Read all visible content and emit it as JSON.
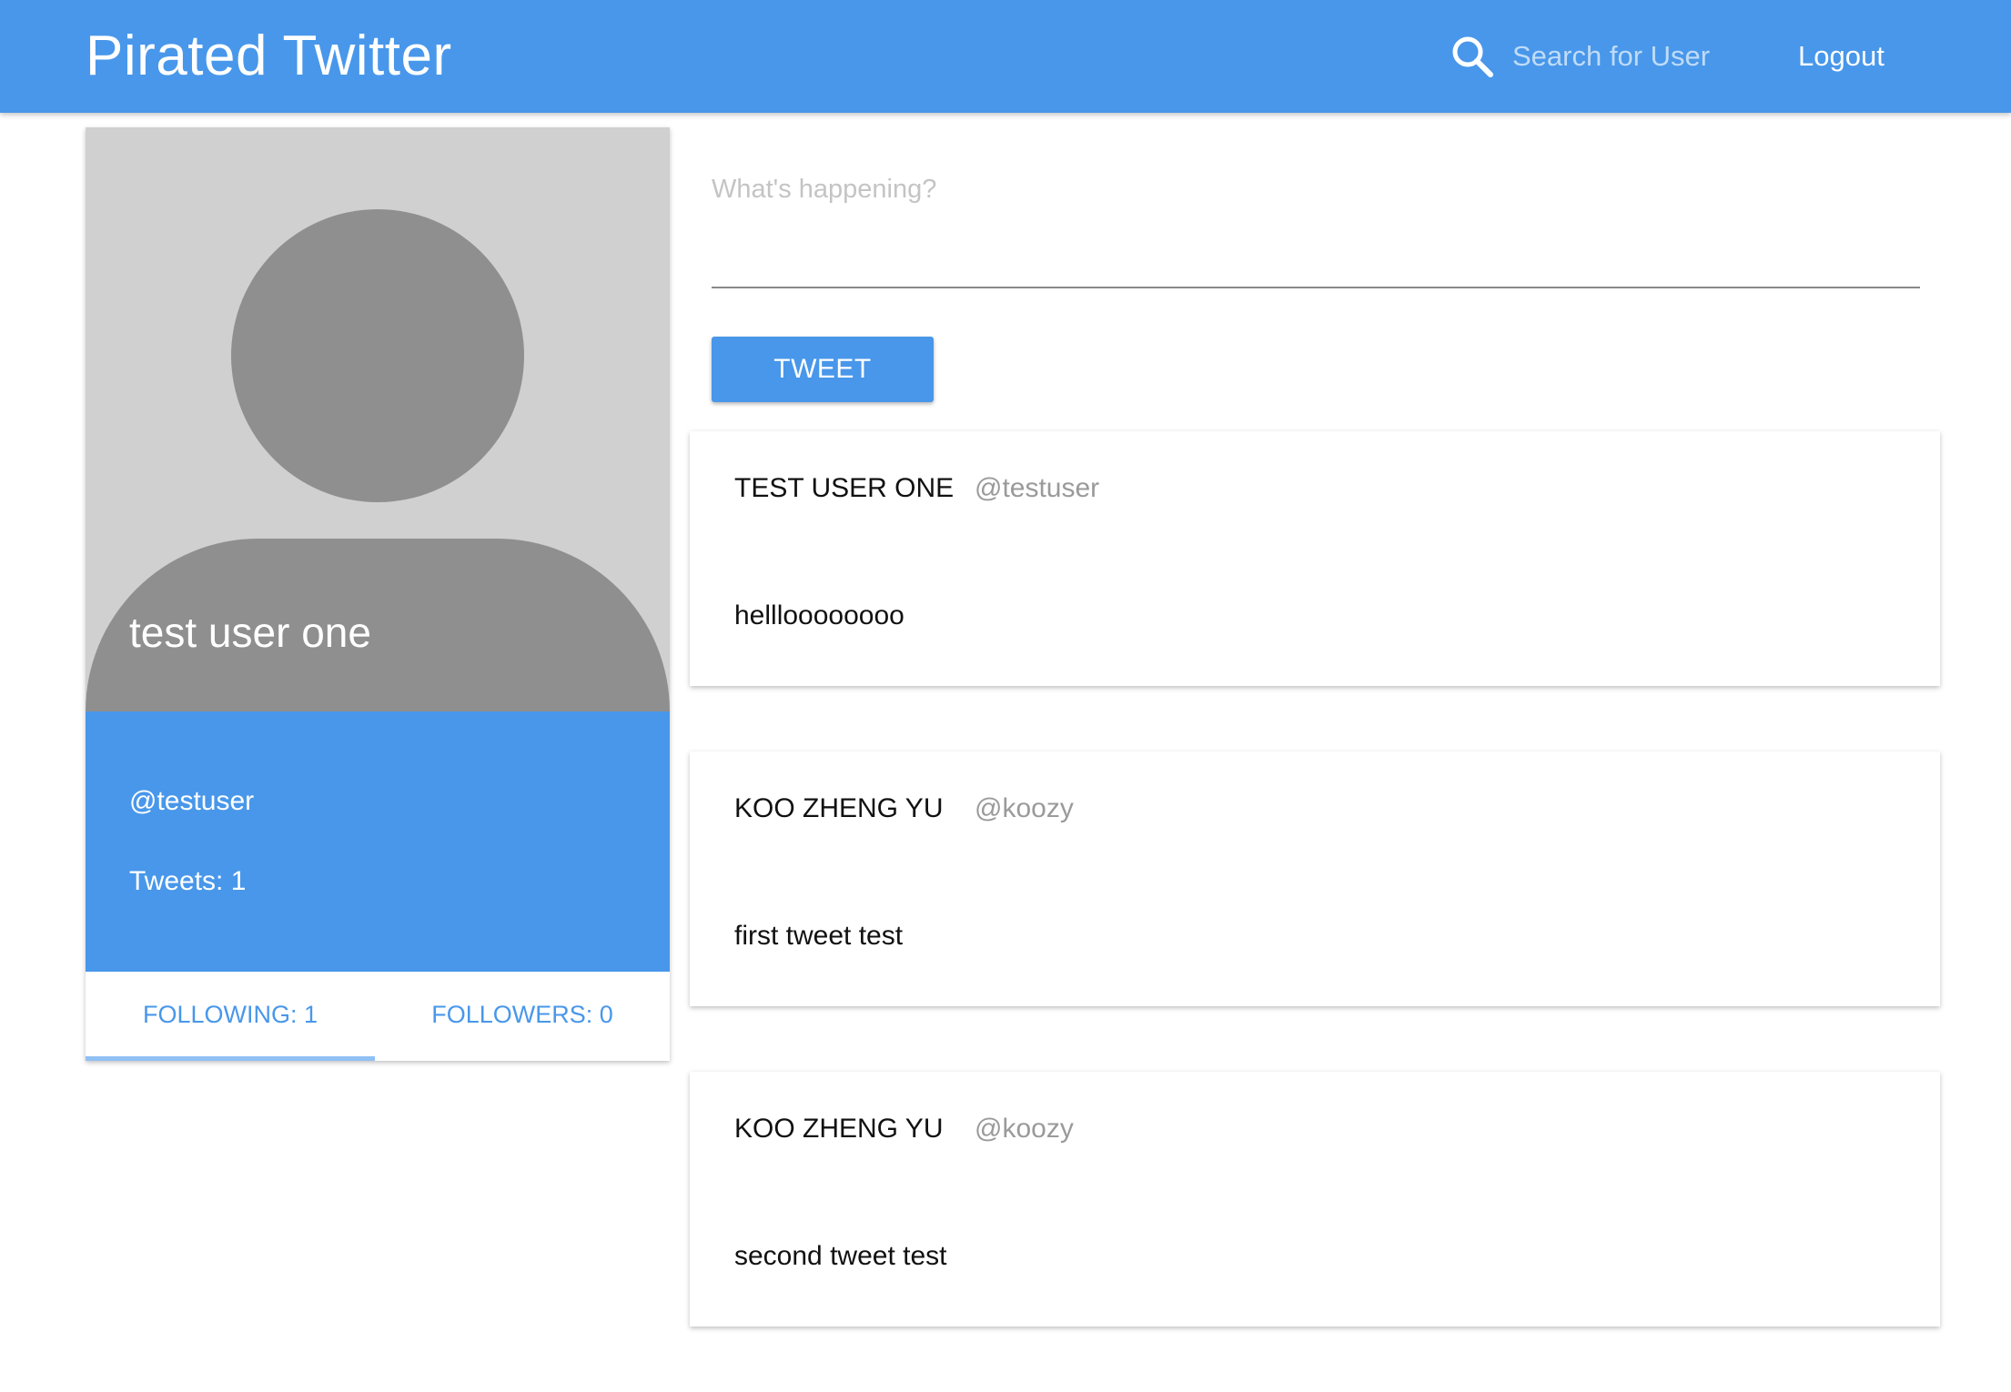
{
  "app": {
    "title": "Pirated Twitter"
  },
  "header": {
    "search": {
      "placeholder": "Search for User",
      "value": ""
    },
    "logout_label": "Logout"
  },
  "profile": {
    "name": "test user one",
    "handle": "@testuser",
    "tweets_label": "Tweets: 1",
    "tabs": {
      "following_label": "FOLLOWING: 1",
      "followers_label": "FOLLOWERS: 0",
      "active": "following"
    }
  },
  "composer": {
    "placeholder": "What's happening?",
    "value": "",
    "button_label": "TWEET"
  },
  "feed": [
    {
      "author": "TEST USER ONE",
      "handle": "@testuser",
      "text": "hellloooooooo"
    },
    {
      "author": "KOO ZHENG YU",
      "handle": "@koozy",
      "text": "first tweet test"
    },
    {
      "author": "KOO ZHENG YU",
      "handle": "@koozy",
      "text": "second tweet test"
    }
  ],
  "colors": {
    "primary": "#4897ea",
    "avatar_bg": "#d0d0d0",
    "avatar_fg": "#8f8f8f",
    "handle_grey": "#9a9a9a"
  },
  "icons": {
    "search": "search-icon",
    "avatar": "default-avatar-silhouette"
  }
}
